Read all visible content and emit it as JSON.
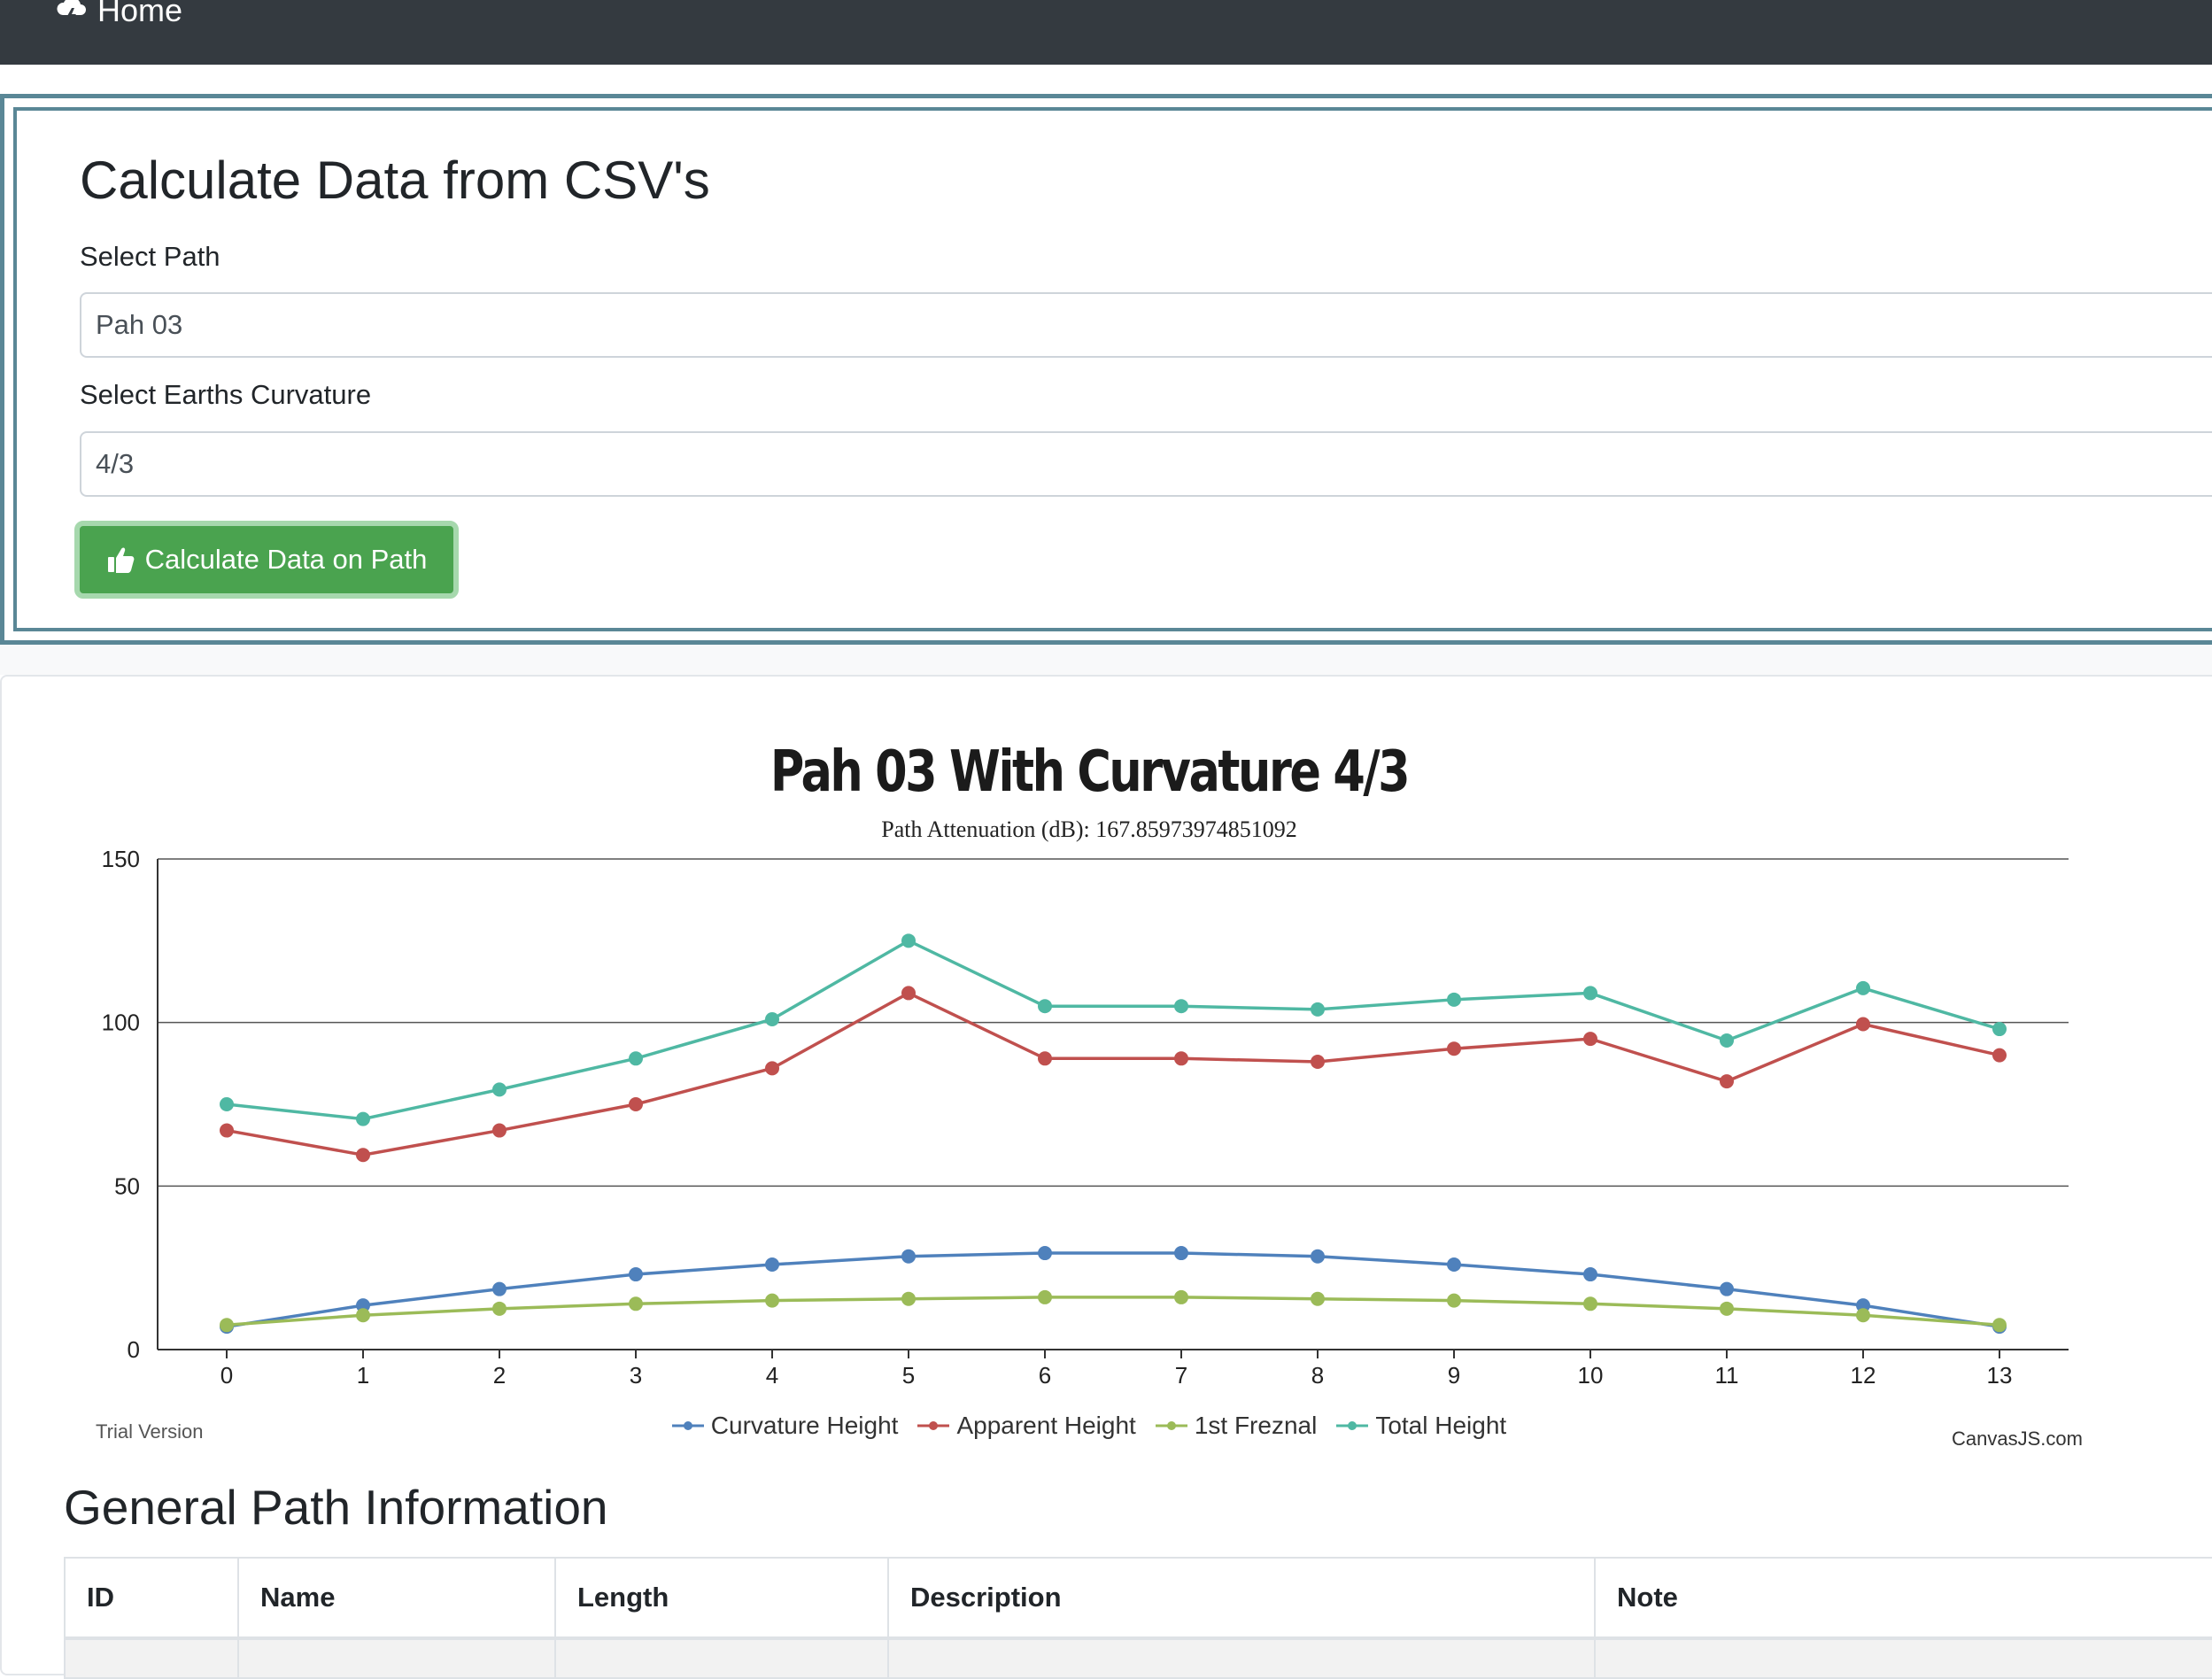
{
  "navbar": {
    "brand_label": "Home"
  },
  "form": {
    "title": "Calculate Data from CSV's",
    "path_label": "Select Path",
    "path_value": "Pah 03",
    "curvature_label": "Select Earths Curvature",
    "curvature_value": "4/3",
    "button_label": "Calculate Data on Path"
  },
  "chart_watermarks": {
    "trial": "Trial Version",
    "credit": "CanvasJS.com"
  },
  "chart_data": {
    "type": "line",
    "title": "Pah 03 With Curvature 4/3",
    "subtitle": "Path Attenuation (dB): 167.85973974851092",
    "x": [
      0,
      1,
      2,
      3,
      4,
      5,
      6,
      7,
      8,
      9,
      10,
      11,
      12,
      13
    ],
    "ylim": [
      0,
      150
    ],
    "yticks": [
      0,
      50,
      100,
      150
    ],
    "grid": true,
    "legend_position": "bottom",
    "series": [
      {
        "name": "Curvature Height",
        "color": "#4f81bc",
        "values": [
          7,
          13.5,
          18.5,
          23,
          26,
          28.5,
          29.5,
          29.5,
          28.5,
          26,
          23,
          18.5,
          13.5,
          7
        ]
      },
      {
        "name": "Apparent Height",
        "color": "#c0504e",
        "values": [
          67,
          59.5,
          67,
          75,
          86,
          109,
          89,
          89,
          88,
          92,
          95,
          82,
          99.5,
          90
        ]
      },
      {
        "name": "1st Freznal",
        "color": "#9bbb58",
        "values": [
          7.5,
          10.5,
          12.5,
          14,
          15,
          15.5,
          16,
          16,
          15.5,
          15,
          14,
          12.5,
          10.5,
          7.5
        ]
      },
      {
        "name": "Total Height",
        "color": "#4fb8a3",
        "values": [
          75,
          70.5,
          79.5,
          89,
          101,
          125,
          105,
          105,
          104,
          107,
          109,
          94.5,
          110.5,
          98
        ]
      }
    ]
  },
  "table": {
    "title": "General Path Information",
    "headers": [
      "ID",
      "Name",
      "Length",
      "Description",
      "Note"
    ]
  }
}
